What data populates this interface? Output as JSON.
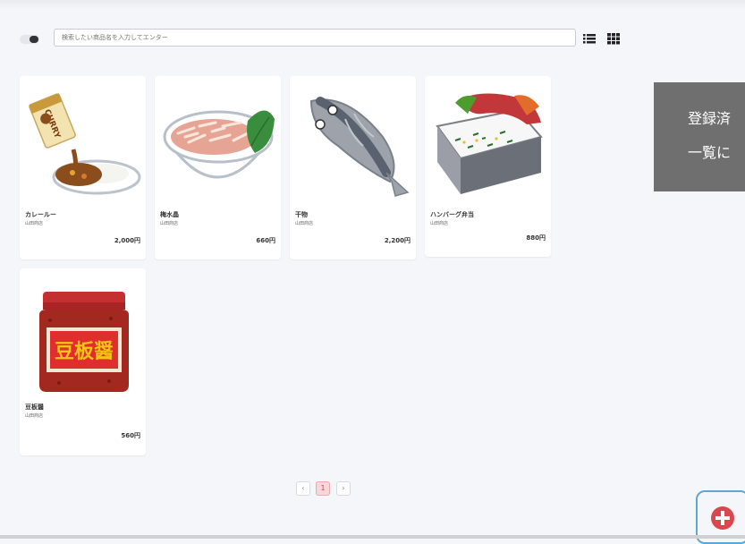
{
  "search": {
    "placeholder": "検索したい商品名を入力してエンター"
  },
  "view_toggle": {
    "list_icon": "list-view-icon",
    "grid_icon": "grid-view-icon"
  },
  "products": [
    {
      "name": "カレールー",
      "shop": "山田商店",
      "price": "2,000円",
      "image": "curry-roux-illustration"
    },
    {
      "name": "梅水晶",
      "shop": "山田商店",
      "price": "660円",
      "image": "ume-suisho-bowl-illustration"
    },
    {
      "name": "干物",
      "shop": "山田商店",
      "price": "2,200円",
      "image": "dried-fish-illustration"
    },
    {
      "name": "ハンバーグ弁当",
      "shop": "山田商店",
      "price": "880円",
      "image": "hamburg-bento-illustration"
    },
    {
      "name": "豆板醤",
      "shop": "山田商店",
      "price": "560円",
      "image": "doubanjiang-jar-illustration",
      "label": "豆板醤"
    }
  ],
  "pagination": {
    "prev": "‹",
    "current": "1",
    "next": "›"
  },
  "toast": {
    "line1": "登録済",
    "line2": "一覧に"
  },
  "colors": {
    "accent": "#d9484f",
    "card_bg": "#ffffff",
    "page_bg": "#f5f6fa",
    "toast_bg": "#6f6f6f"
  }
}
